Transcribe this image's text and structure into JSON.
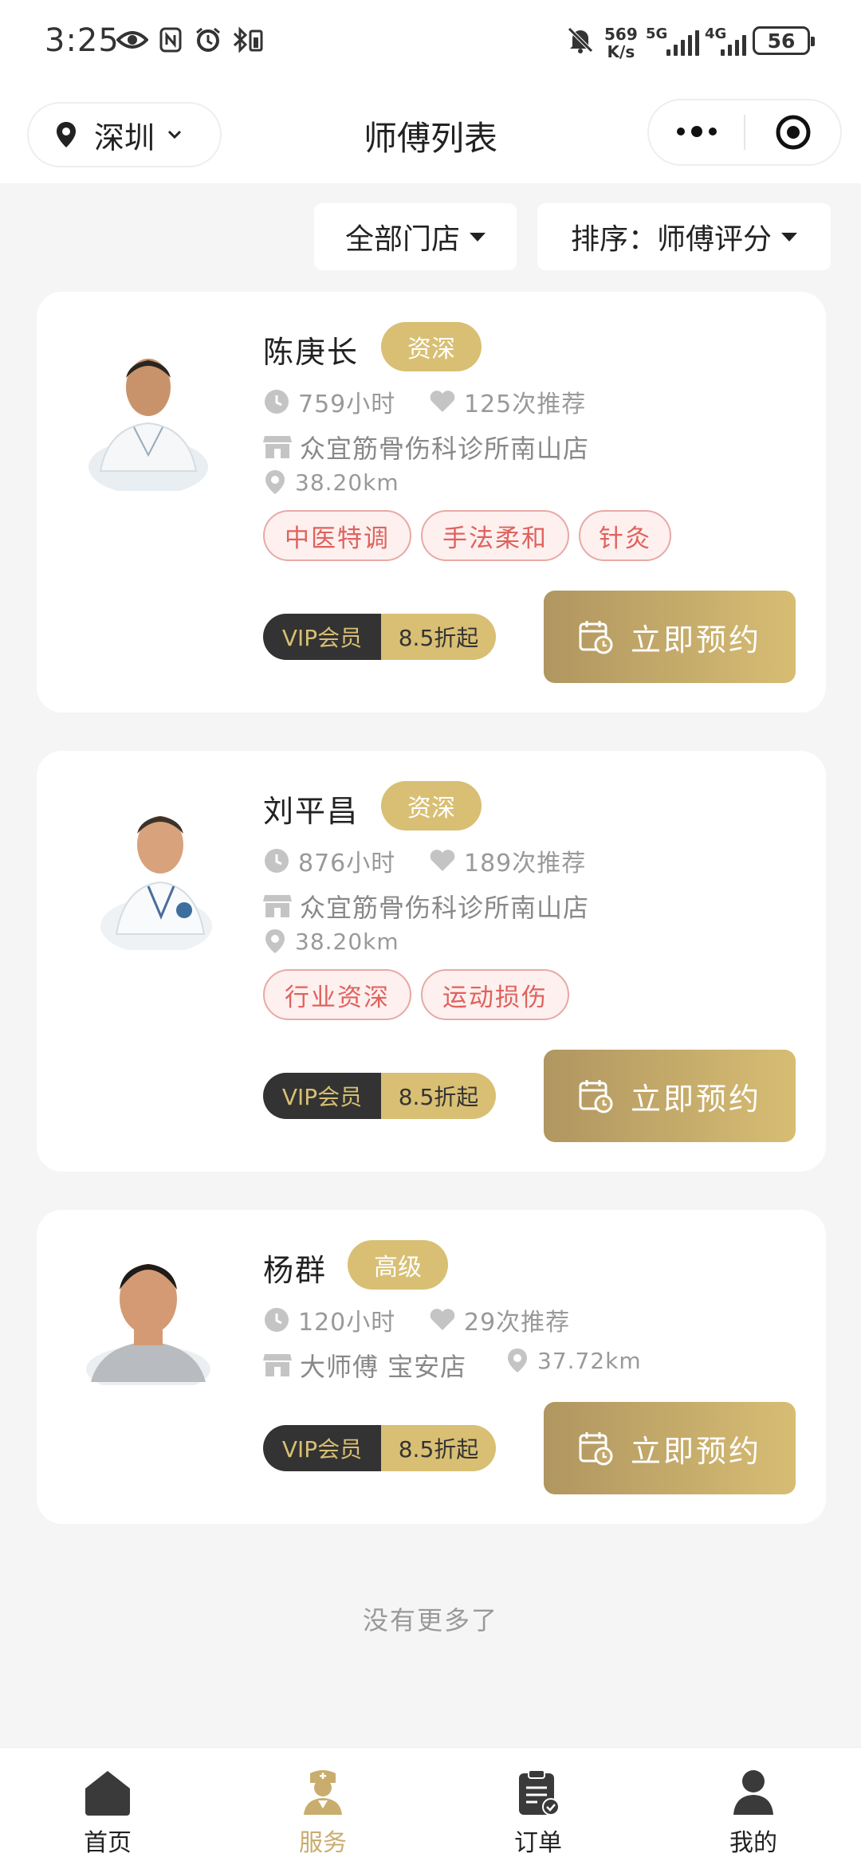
{
  "status_bar": {
    "time": "3:25",
    "net_speed_value": "569",
    "net_speed_unit": "K/s",
    "signal1_label": "5G",
    "signal2_label": "4G",
    "battery": "56"
  },
  "header": {
    "city": "深圳",
    "title": "师傅列表"
  },
  "filters": {
    "store": "全部门店",
    "sort": "排序：师傅评分"
  },
  "masters": [
    {
      "name": "陈庚长",
      "level": "资深",
      "hours": "759小时",
      "recommend": "125次推荐",
      "store": "众宜筋骨伤科诊所南山店",
      "distance": "38.20km",
      "tags": [
        "中医特调",
        "手法柔和",
        "针灸"
      ],
      "vip_label": "VIP会员",
      "discount": "8.5折起",
      "book_label": "立即预约"
    },
    {
      "name": "刘平昌",
      "level": "资深",
      "hours": "876小时",
      "recommend": "189次推荐",
      "store": "众宜筋骨伤科诊所南山店",
      "distance": "38.20km",
      "tags": [
        "行业资深",
        "运动损伤"
      ],
      "vip_label": "VIP会员",
      "discount": "8.5折起",
      "book_label": "立即预约"
    },
    {
      "name": "杨群",
      "level": "高级",
      "hours": "120小时",
      "recommend": "29次推荐",
      "store": "大师傅 宝安店",
      "distance": "37.72km",
      "tags": [],
      "vip_label": "VIP会员",
      "discount": "8.5折起",
      "book_label": "立即预约"
    }
  ],
  "footer_text": "没有更多了",
  "tabbar": [
    {
      "label": "首页",
      "icon": "home-icon"
    },
    {
      "label": "服务",
      "icon": "nurse-icon"
    },
    {
      "label": "订单",
      "icon": "clipboard-icon"
    },
    {
      "label": "我的",
      "icon": "user-icon"
    }
  ],
  "colors": {
    "gold": "#d8bf73",
    "tag_red": "#e0625d",
    "active_tab": "#c9ad6e"
  }
}
